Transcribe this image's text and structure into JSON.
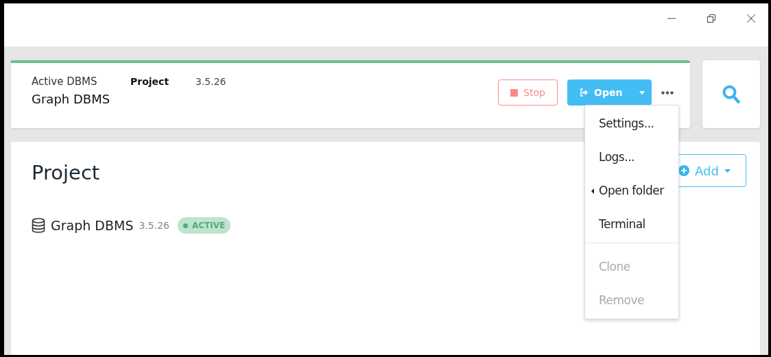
{
  "active_dbms": {
    "label": "Active DBMS",
    "project_label": "Project",
    "version": "3.5.26",
    "name": "Graph DBMS",
    "buttons": [
      {
        "kind": "stop",
        "label": "Stop"
      },
      {
        "kind": "open",
        "label": "Open"
      }
    ]
  },
  "menu": {
    "items": [
      {
        "label": "Settings...",
        "disabled": false,
        "submenu": false
      },
      {
        "label": "Logs...",
        "disabled": false,
        "submenu": false
      },
      {
        "label": "Open folder",
        "disabled": false,
        "submenu": true
      },
      {
        "label": "Terminal",
        "disabled": false,
        "submenu": false
      },
      {
        "label": "Clone",
        "disabled": true,
        "submenu": false
      },
      {
        "label": "Remove",
        "disabled": true,
        "submenu": false
      }
    ]
  },
  "project": {
    "title": "Project",
    "add_button": "Add",
    "dbms": [
      {
        "name": "Graph DBMS",
        "version": "3.5.26",
        "status": "ACTIVE"
      }
    ]
  }
}
